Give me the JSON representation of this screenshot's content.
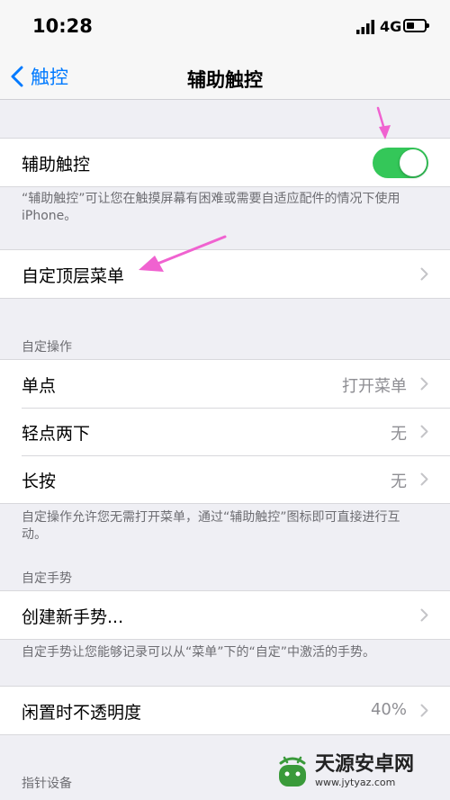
{
  "status": {
    "time": "10:28",
    "network": "4G"
  },
  "nav": {
    "back_label": "触控",
    "title": "辅助触控"
  },
  "assistive_touch": {
    "label": "辅助触控",
    "enabled": true,
    "footnote": "“辅助触控”可让您在触摸屏幕有困难或需要自适应配件的情况下使用iPhone。"
  },
  "customize_top_menu": {
    "label": "自定顶层菜单"
  },
  "custom_actions": {
    "header": "自定操作",
    "items": [
      {
        "label": "单点",
        "value": "打开菜单"
      },
      {
        "label": "轻点两下",
        "value": "无"
      },
      {
        "label": "长按",
        "value": "无"
      }
    ],
    "footnote": "自定操作允许您无需打开菜单，通过“辅助触控”图标即可直接进行互动。"
  },
  "custom_gestures": {
    "header": "自定手势",
    "create_label": "创建新手势...",
    "footnote": "自定手势让您能够记录可以从“菜单”下的“自定”中激活的手势。"
  },
  "idle_opacity": {
    "label": "闲置时不透明度",
    "value": "40%"
  },
  "pointer_devices": {
    "header": "指针设备"
  },
  "watermark": {
    "title": "天源安卓网",
    "url": "www.jytyaz.com"
  },
  "colors": {
    "accent": "#007aff",
    "toggle_on": "#34c759",
    "annotation": "#f062d0"
  },
  "icons": [
    "chevron-left-icon",
    "chevron-right-icon",
    "signal-icon",
    "battery-icon"
  ]
}
